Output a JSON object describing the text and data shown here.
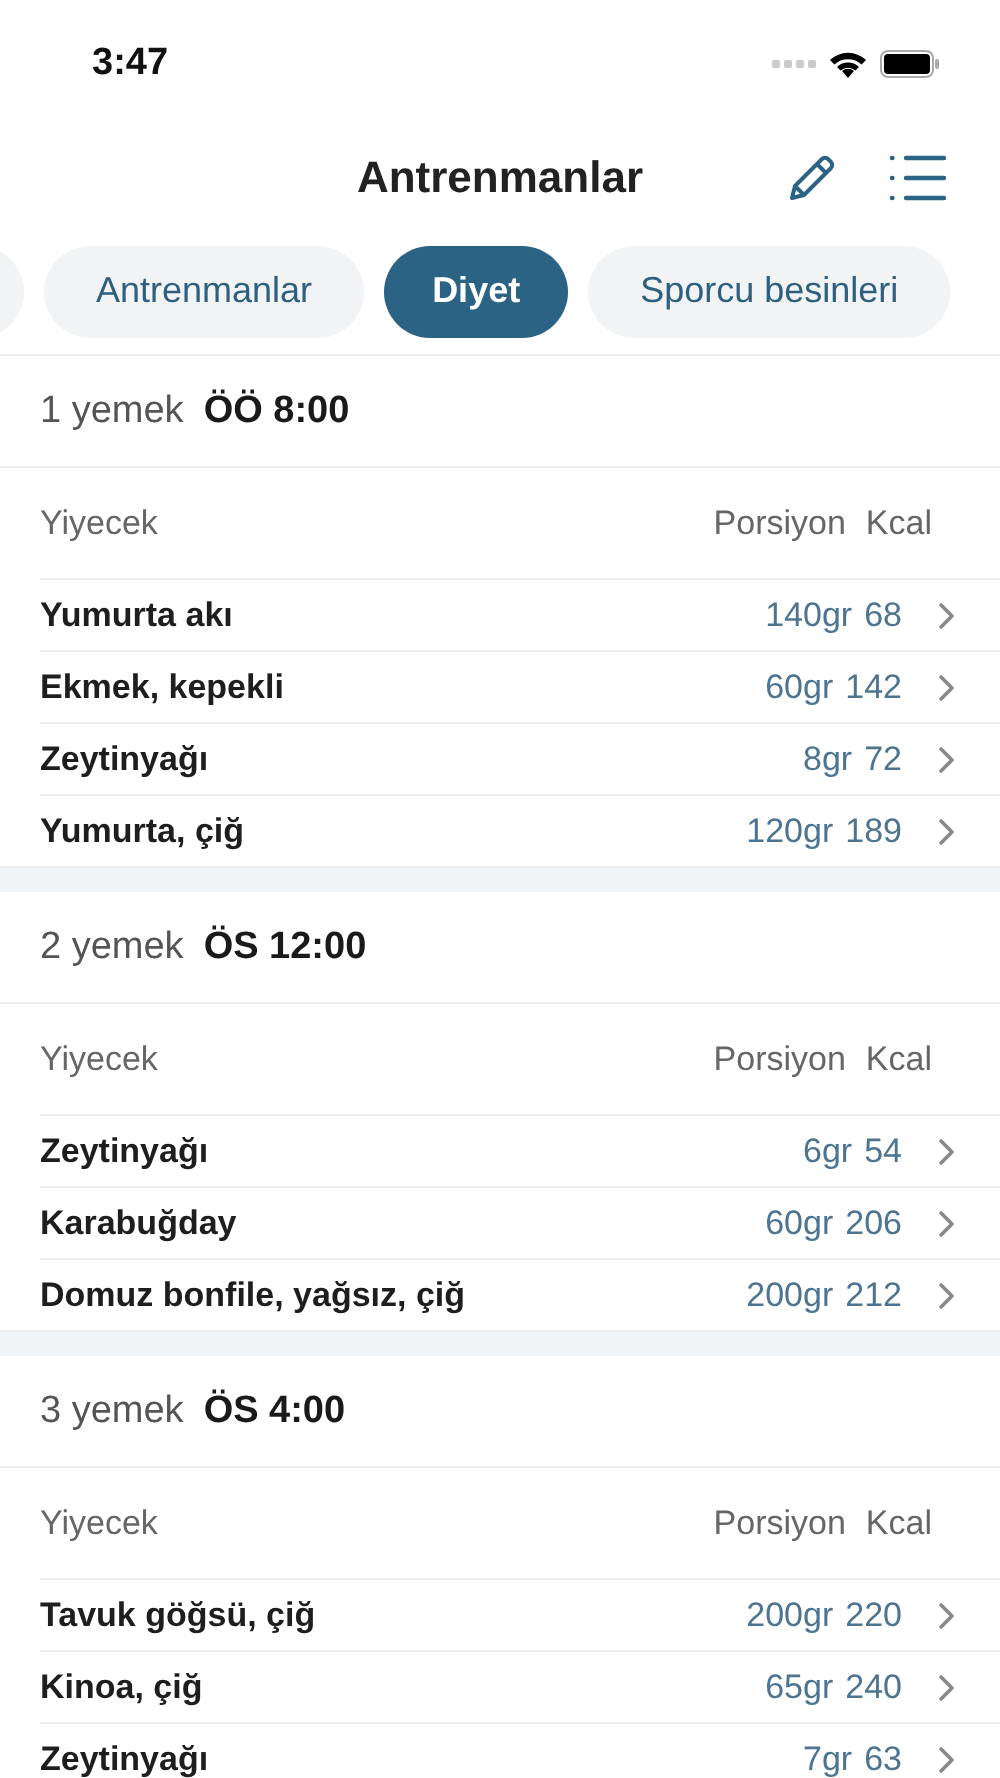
{
  "status_bar": {
    "time": "3:47"
  },
  "nav": {
    "title": "Antrenmanlar"
  },
  "tabs": [
    {
      "label": "Antrenmanlar",
      "selected": false
    },
    {
      "label": "Diyet",
      "selected": true
    },
    {
      "label": "Sporcu besinleri",
      "selected": false
    }
  ],
  "meals": [
    {
      "label": "1 yemek",
      "time": "ÖÖ 8:00",
      "columns": [
        "Yiyecek",
        "Porsiyon",
        "Kcal"
      ],
      "items": [
        {
          "name": "Yumurta akı",
          "portion": "140gr",
          "kcal": "68"
        },
        {
          "name": "Ekmek, kepekli",
          "portion": "60gr",
          "kcal": "142"
        },
        {
          "name": "Zeytinyağı",
          "portion": "8gr",
          "kcal": "72"
        },
        {
          "name": "Yumurta, çiğ",
          "portion": "120gr",
          "kcal": "189"
        }
      ]
    },
    {
      "label": "2 yemek",
      "time": "ÖS 12:00",
      "columns": [
        "Yiyecek",
        "Porsiyon",
        "Kcal"
      ],
      "items": [
        {
          "name": "Zeytinyağı",
          "portion": "6gr",
          "kcal": "54"
        },
        {
          "name": "Karabuğday",
          "portion": "60gr",
          "kcal": "206"
        },
        {
          "name": "Domuz bonfile, yağsız, çiğ",
          "portion": "200gr",
          "kcal": "212"
        }
      ]
    },
    {
      "label": "3 yemek",
      "time": "ÖS 4:00",
      "columns": [
        "Yiyecek",
        "Porsiyon",
        "Kcal"
      ],
      "items": [
        {
          "name": "Tavuk göğsü, çiğ",
          "portion": "200gr",
          "kcal": "220"
        },
        {
          "name": "Kinoa, çiğ",
          "portion": "65gr",
          "kcal": "240"
        },
        {
          "name": "Zeytinyağı",
          "portion": "7gr",
          "kcal": "63"
        }
      ]
    }
  ]
}
